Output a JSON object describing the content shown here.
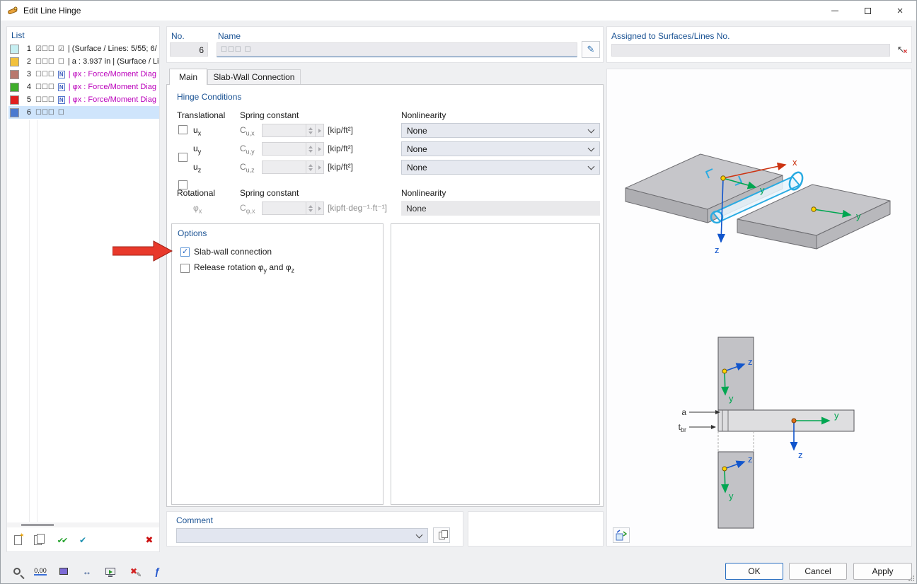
{
  "window": {
    "title": "Edit Line Hinge"
  },
  "icons": {
    "star": "✶",
    "double_check": "✔✔",
    "check": "✔",
    "delete": "✖",
    "pencil": "✎",
    "pick": "↖",
    "cross": "×",
    "dim": "↔",
    "fx": "ƒ"
  },
  "list": {
    "title": "List",
    "items": [
      {
        "num": "1",
        "swatch": "#c6eff2",
        "checks": "☑☐☐",
        "extra": "☑",
        "extra_kind": "check",
        "text": "| (Surface / Lines: 5/55; 6/"
      },
      {
        "num": "2",
        "swatch": "#f2c13c",
        "checks": "☐☐☐",
        "extra": "☐",
        "extra_kind": "check",
        "text": "| a : 3.937 in | (Surface / Li"
      },
      {
        "num": "3",
        "swatch": "#b8786d",
        "checks": "☐☐☐",
        "extra": "N",
        "extra_kind": "n",
        "text": "| φx : Force/Moment Diag",
        "text_color": "#bb00bb"
      },
      {
        "num": "4",
        "swatch": "#3fae2a",
        "checks": "☐☐☐",
        "extra": "N",
        "extra_kind": "n",
        "text": "| φx : Force/Moment Diag",
        "text_color": "#bb00bb"
      },
      {
        "num": "5",
        "swatch": "#e02020",
        "checks": "☐☐☐",
        "extra": "N",
        "extra_kind": "n",
        "text": "| φx : Force/Moment Diag",
        "text_color": "#bb00bb"
      },
      {
        "num": "6",
        "swatch": "#4a7ad0",
        "checks": "☐☐☐",
        "extra": "☐",
        "extra_kind": "check",
        "text": "",
        "row_bg": "#cfe5fc"
      }
    ]
  },
  "header": {
    "no_label": "No.",
    "no_value": "6",
    "name_label": "Name",
    "name_prefix": "☐☐☐  ☐",
    "name_value": "",
    "assigned_label": "Assigned to Surfaces/Lines No.",
    "assigned_value": ""
  },
  "tabs": {
    "main": "Main",
    "slab_wall": "Slab-Wall Connection"
  },
  "hinge": {
    "title": "Hinge Conditions",
    "translational": "Translational",
    "spring": "Spring constant",
    "nonlinearity": "Nonlinearity",
    "rotational": "Rotational",
    "c": "C",
    "rows": [
      {
        "sym": "u",
        "sub": "x",
        "c_sub": "u,x",
        "unit": "[kip/ft²]",
        "nonlin": "None",
        "cb": "unchecked"
      },
      {
        "sym": "u",
        "sub": "y",
        "c_sub": "u,y",
        "unit": "[kip/ft²]",
        "nonlin": "None",
        "cb": "unchecked"
      },
      {
        "sym": "u",
        "sub": "z",
        "c_sub": "u,z",
        "unit": "[kip/ft²]",
        "nonlin": "None",
        "cb": "unchecked"
      }
    ],
    "rot": {
      "sym": "φ",
      "sub": "x",
      "c_sub": "φ,x",
      "unit": "[kipft·deg⁻¹·ft⁻¹]",
      "nonlin": "None",
      "cb": "disabled"
    }
  },
  "options": {
    "title": "Options",
    "cb1_label": "Slab-wall connection",
    "cb1_state": "checked",
    "cb2_state": "unchecked",
    "release_p1": "Release rotation φ",
    "release_s1": "y",
    "release_p2": " and φ",
    "release_s2": "z"
  },
  "comment": {
    "label": "Comment",
    "value": ""
  },
  "actions": {
    "ok": "OK",
    "cancel": "Cancel",
    "apply": "Apply"
  },
  "toolbar": {
    "zero": "0,00"
  },
  "graphics": {
    "axes": {
      "x": "x",
      "y": "y",
      "z": "z"
    },
    "dims": {
      "a": "a",
      "t": "t",
      "t_sub": "br"
    }
  }
}
